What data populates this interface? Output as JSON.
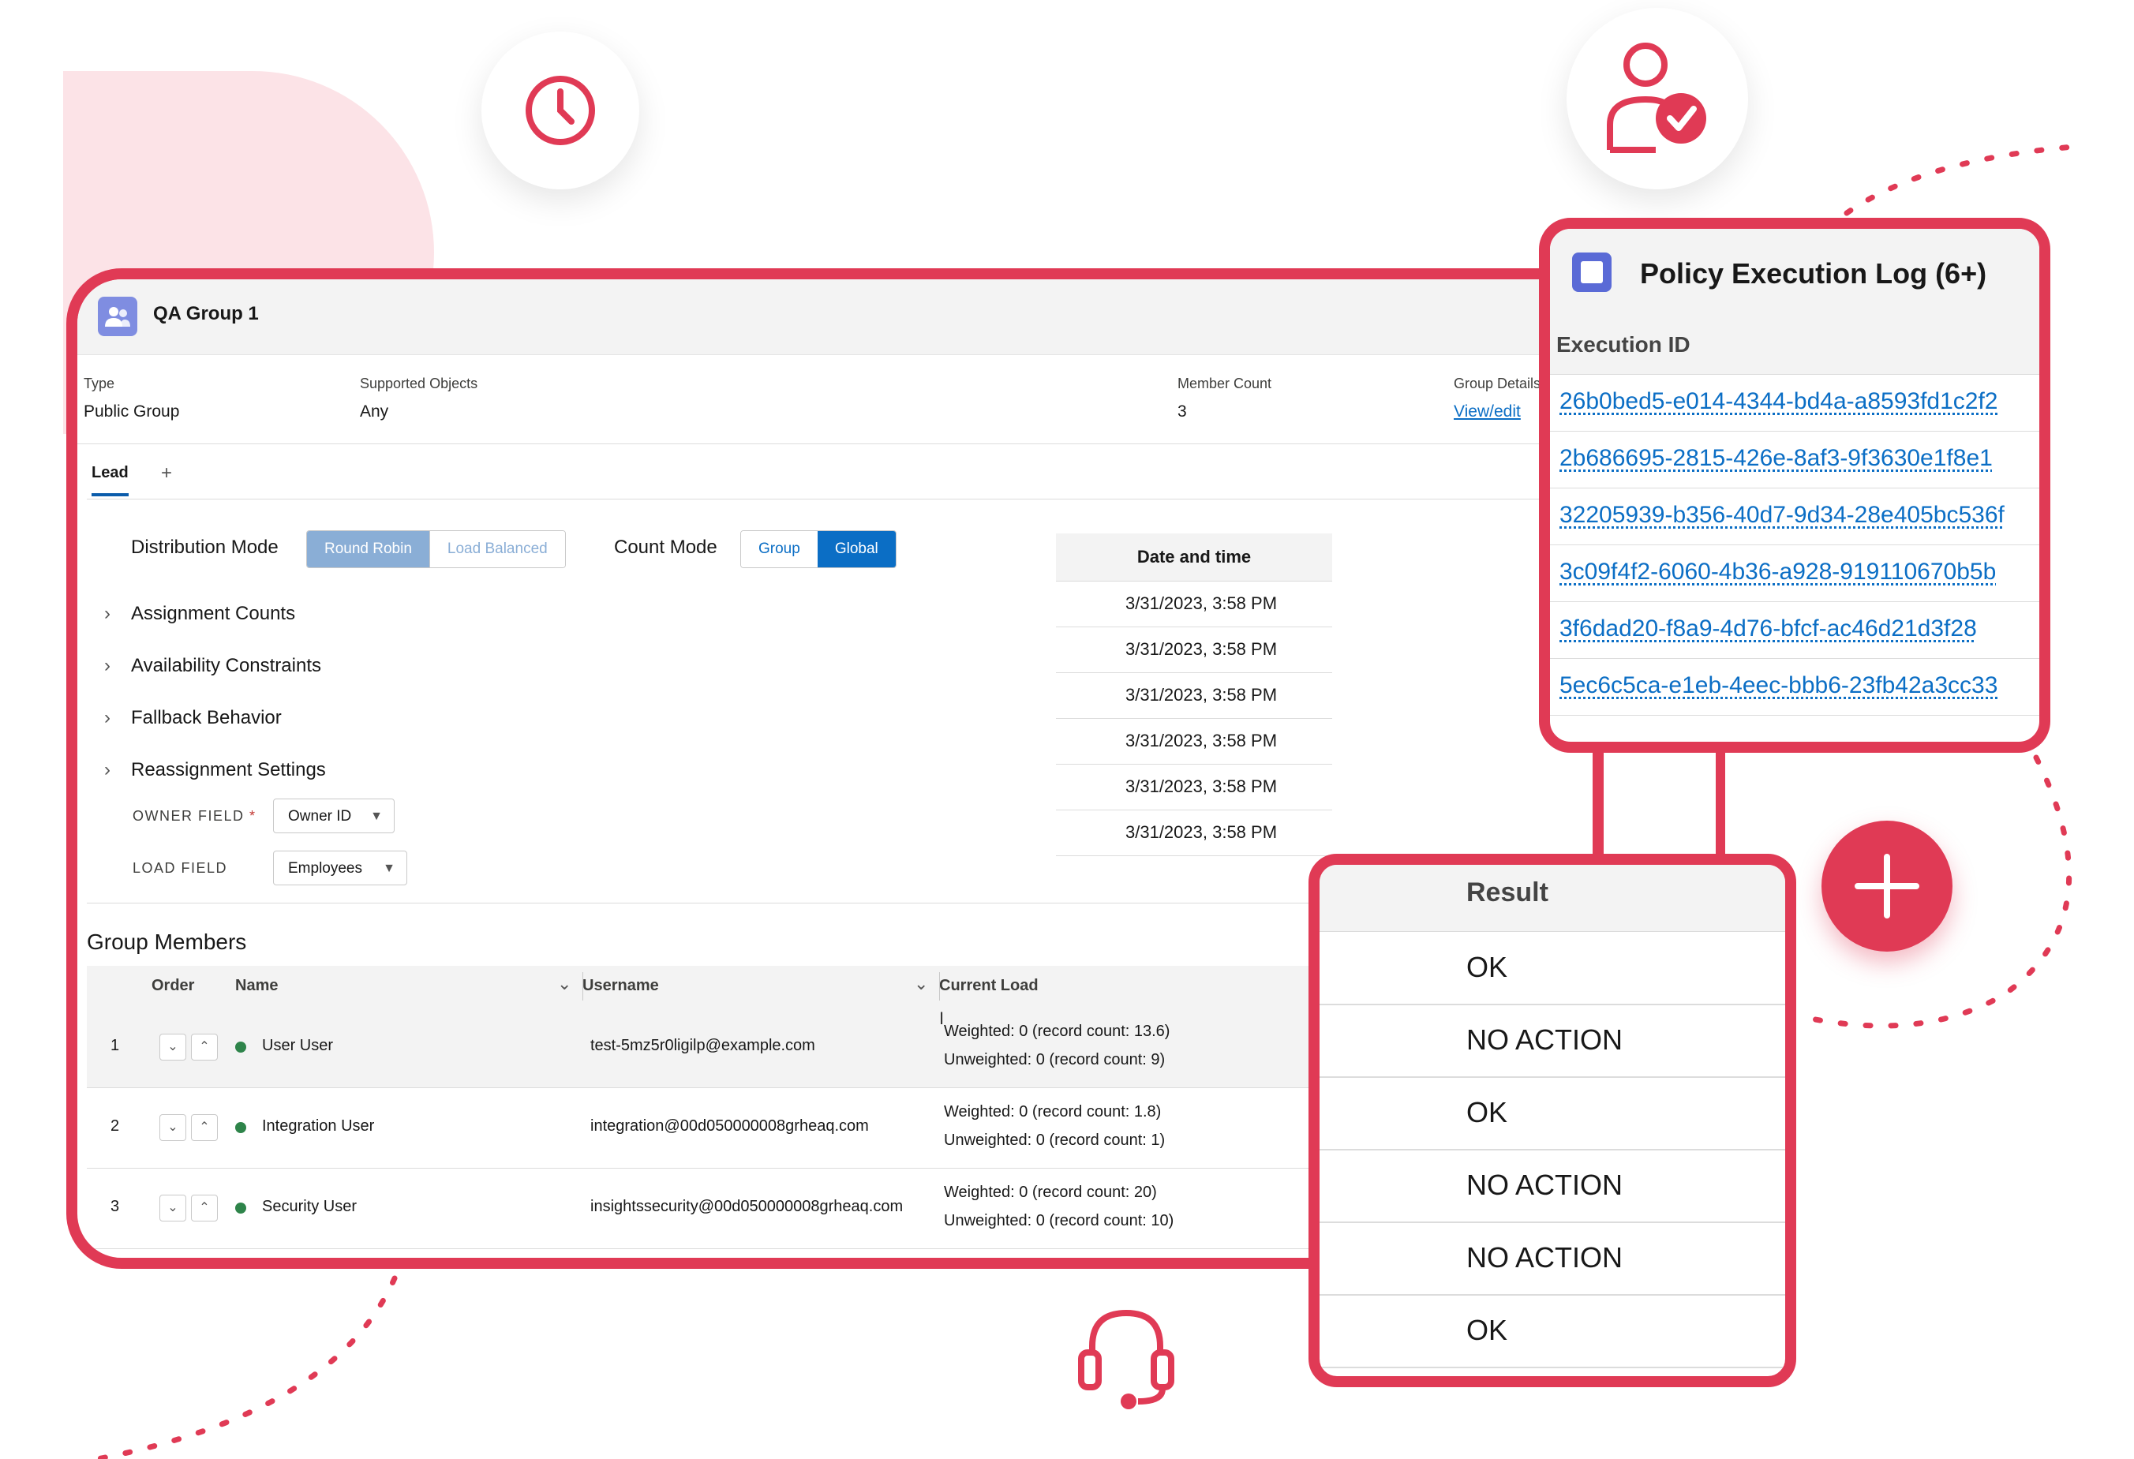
{
  "colors": {
    "accent": "#e03a55",
    "brand_blue": "#0b6ec5",
    "status_green": "#2e844a"
  },
  "decor_icons": [
    "clock-icon",
    "user-check-icon",
    "headset-icon",
    "plus-icon"
  ],
  "group": {
    "title": "QA Group 1",
    "fields": [
      {
        "label": "Type",
        "value": "Public Group"
      },
      {
        "label": "Supported Objects",
        "value": "Any"
      },
      {
        "label": "Member Count",
        "value": "3"
      },
      {
        "label": "Group Details",
        "value": "View/edit"
      }
    ]
  },
  "tabs": {
    "active": "Lead",
    "add": "+"
  },
  "distribution": {
    "label": "Distribution Mode",
    "options": [
      "Round Robin",
      "Load Balanced"
    ],
    "selected": "Round Robin"
  },
  "count_mode": {
    "label": "Count Mode",
    "options": [
      "Group",
      "Global"
    ],
    "selected": "Global"
  },
  "accordions": [
    "Assignment Counts",
    "Availability Constraints",
    "Fallback Behavior",
    "Reassignment Settings"
  ],
  "owner_field": {
    "label": "OWNER FIELD",
    "required": "*",
    "value": "Owner ID"
  },
  "load_field": {
    "label": "LOAD FIELD",
    "value": "Employees"
  },
  "datetime_table": {
    "header": "Date and time",
    "rows": [
      "3/31/2023, 3:58 PM",
      "3/31/2023, 3:58 PM",
      "3/31/2023, 3:58 PM",
      "3/31/2023, 3:58 PM",
      "3/31/2023, 3:58 PM",
      "3/31/2023, 3:58 PM"
    ]
  },
  "members": {
    "title": "Group Members",
    "columns": [
      "Order",
      "Name",
      "Username",
      "Current Load"
    ],
    "rows": [
      {
        "order": "1",
        "name": "User User",
        "username": "test-5mz5r0ligilp@example.com",
        "weighted": "Weighted: 0 (record count: 13.6)",
        "unweighted": "Unweighted: 0 (record count: 9)"
      },
      {
        "order": "2",
        "name": "Integration User",
        "username": "integration@00d050000008grheaq.com",
        "weighted": "Weighted: 0 (record count: 1.8)",
        "unweighted": "Unweighted: 0 (record count: 1)"
      },
      {
        "order": "3",
        "name": "Security User",
        "username": "insightssecurity@00d050000008grheaq.com",
        "weighted": "Weighted: 0 (record count: 20)",
        "unweighted": "Unweighted: 0 (record count: 10)"
      }
    ]
  },
  "policy_log": {
    "title": "Policy Execution Log (6+)",
    "column": "Execution ID",
    "ids": [
      "26b0bed5-e014-4344-bd4a-a8593fd1c2f2",
      "2b686695-2815-426e-8af3-9f3630e1f8e1",
      "32205939-b356-40d7-9d34-28e405bc536f",
      "3c09f4f2-6060-4b36-a928-919110670b5b",
      "3f6dad20-f8a9-4d76-bfcf-ac46d21d3f28",
      "5ec6c5ca-e1eb-4eec-bbb6-23fb42a3cc33"
    ]
  },
  "results": {
    "header": "Result",
    "rows": [
      "OK",
      "NO ACTION",
      "OK",
      "NO ACTION",
      "NO ACTION",
      "OK"
    ]
  }
}
